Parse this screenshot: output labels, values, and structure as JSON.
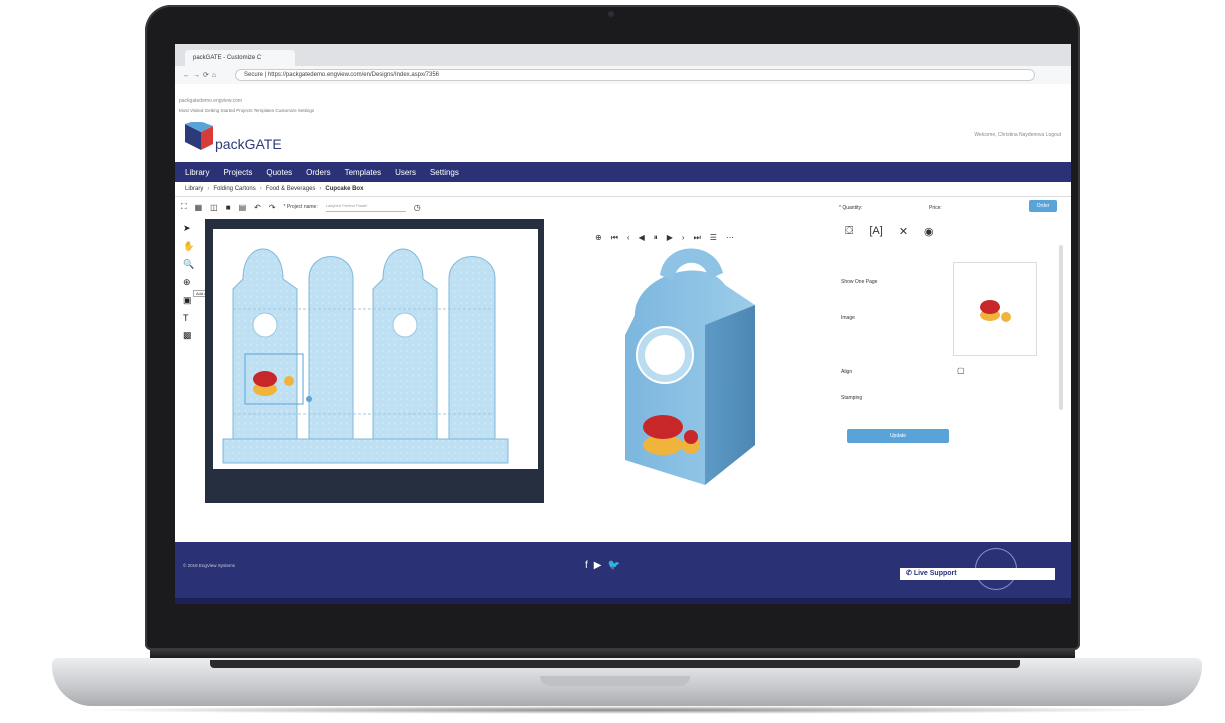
{
  "browser": {
    "tab_title": "packGATE - Customize C",
    "address": "Secure | https://packgatedemo.engview.com/en/Designs/Index.aspx/7356",
    "inner_address": "packgatedemo.engview.com",
    "bookmarks": "Most Visited   Getting Started   Projects   Templates   Customize   Settings"
  },
  "header": {
    "brand": "packGATE",
    "user_links": "Welcome, Christina Naydenova   Logout"
  },
  "nav": {
    "items": [
      {
        "label": "Library"
      },
      {
        "label": "Projects"
      },
      {
        "label": "Quotes"
      },
      {
        "label": "Orders"
      },
      {
        "label": "Templates"
      },
      {
        "label": "Users"
      },
      {
        "label": "Settings"
      }
    ]
  },
  "breadcrumb": {
    "items": [
      "Library",
      "Folding Cartons",
      "Food & Beverages",
      "Cupcake Box"
    ]
  },
  "editor": {
    "project_name_label": "* Project name:",
    "project_name_placeholder": "Ladybird Perfect Pastel",
    "tooltip": "Add content"
  },
  "right_panel": {
    "quantity_label": "* Quantity:",
    "price_label": "Price:",
    "order_label": "Order",
    "show_one_page": "Show One Page",
    "image_label": "Image",
    "align_label": "Align",
    "stamping_label": "Stamping",
    "update_label": "Update"
  },
  "footer": {
    "copyright": "© 2018 EngView Systems",
    "live_support": "Live Support"
  },
  "colors": {
    "nav_bg": "#2b3175",
    "accent": "#5aa3d9",
    "box_blue": "#8ec3e6"
  }
}
